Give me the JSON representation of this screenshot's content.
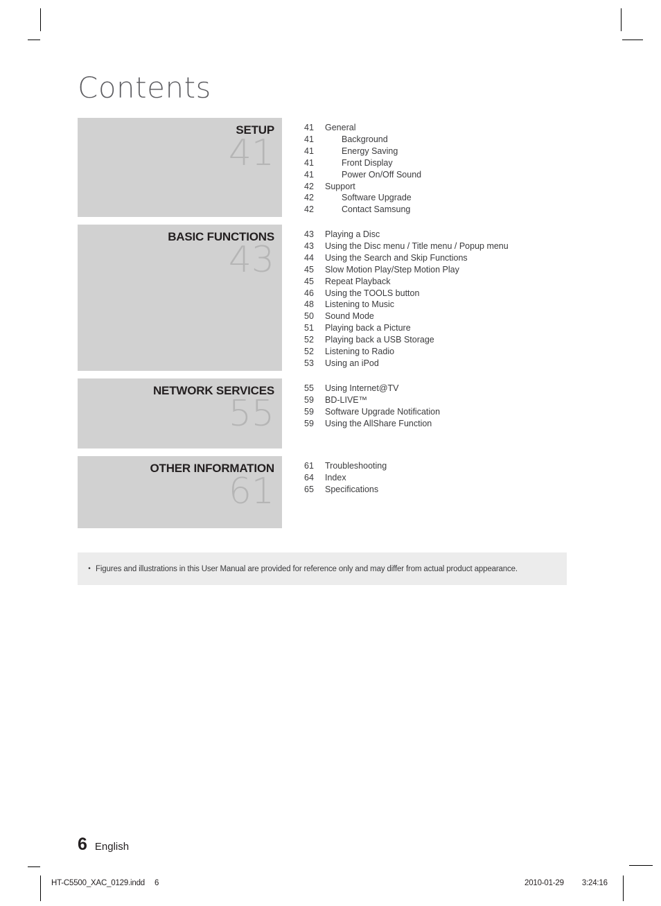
{
  "page": {
    "title": "Contents",
    "number": "6",
    "language": "English"
  },
  "colors": {
    "section_box_bg": "#d1d1d1",
    "section_number": "#b5b5b5",
    "note_box_bg": "#ececec",
    "text": "#3a3a3c",
    "title": "#5b5b5f"
  },
  "sections": [
    {
      "label": "SETUP",
      "number": "41",
      "entries": [
        {
          "page": "41",
          "title": "General",
          "level": 1
        },
        {
          "page": "41",
          "title": "Background",
          "level": 2
        },
        {
          "page": "41",
          "title": "Energy Saving",
          "level": 2
        },
        {
          "page": "41",
          "title": "Front Display",
          "level": 2
        },
        {
          "page": "41",
          "title": "Power On/Off Sound",
          "level": 2
        },
        {
          "page": "42",
          "title": "Support",
          "level": 1
        },
        {
          "page": "42",
          "title": "Software Upgrade",
          "level": 2
        },
        {
          "page": "42",
          "title": "Contact Samsung",
          "level": 2
        }
      ]
    },
    {
      "label": "BASIC FUNCTIONS",
      "number": "43",
      "entries": [
        {
          "page": "43",
          "title": "Playing a Disc",
          "level": 1
        },
        {
          "page": "43",
          "title": "Using the Disc menu / Title menu / Popup menu",
          "level": 1
        },
        {
          "page": "44",
          "title": "Using the Search and Skip Functions",
          "level": 1
        },
        {
          "page": "45",
          "title": "Slow Motion Play/Step Motion Play",
          "level": 1
        },
        {
          "page": "45",
          "title": "Repeat Playback",
          "level": 1
        },
        {
          "page": "46",
          "title": "Using the TOOLS button",
          "level": 1
        },
        {
          "page": "48",
          "title": "Listening to Music",
          "level": 1
        },
        {
          "page": "50",
          "title": "Sound Mode",
          "level": 1
        },
        {
          "page": "51",
          "title": "Playing back a Picture",
          "level": 1
        },
        {
          "page": "52",
          "title": "Playing back a USB Storage",
          "level": 1
        },
        {
          "page": "52",
          "title": "Listening to Radio",
          "level": 1
        },
        {
          "page": "53",
          "title": "Using an iPod",
          "level": 1
        }
      ]
    },
    {
      "label": "NETWORK SERVICES",
      "number": "55",
      "entries": [
        {
          "page": "55",
          "title": "Using Internet@TV",
          "level": 1
        },
        {
          "page": "59",
          "title": "BD-LIVE™",
          "level": 1
        },
        {
          "page": "59",
          "title": "Software Upgrade Notification",
          "level": 1
        },
        {
          "page": "59",
          "title": "Using the AllShare Function",
          "level": 1
        }
      ]
    },
    {
      "label": "OTHER INFORMATION",
      "number": "61",
      "entries": [
        {
          "page": "61",
          "title": "Troubleshooting",
          "level": 1
        },
        {
          "page": "64",
          "title": "Index",
          "level": 1
        },
        {
          "page": "65",
          "title": "Specifications",
          "level": 1
        }
      ]
    }
  ],
  "note": {
    "bullet": "•",
    "text": "Figures and illustrations in this User Manual are provided for reference only and may differ from actual product appearance."
  },
  "print_footer": {
    "file_name": "HT-C5500_XAC_0129.indd",
    "file_page": "6",
    "date": "2010-01-29",
    "time": "3:24:16"
  }
}
